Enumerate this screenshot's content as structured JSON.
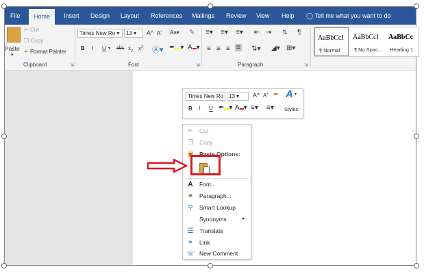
{
  "tabs": [
    {
      "label": "File"
    },
    {
      "label": "Home",
      "active": true
    },
    {
      "label": "Insert"
    },
    {
      "label": "Design"
    },
    {
      "label": "Layout"
    },
    {
      "label": "References"
    },
    {
      "label": "Mailings"
    },
    {
      "label": "Review"
    },
    {
      "label": "View"
    },
    {
      "label": "Help"
    }
  ],
  "tell_me": "Tell me what you want to do",
  "clipboard": {
    "paste": "Paste",
    "cut": "Cut",
    "copy": "Copy",
    "format_painter": "Format Painter",
    "label": "Clipboard"
  },
  "font": {
    "name": "Times New Ro",
    "size": "13",
    "label": "Font",
    "grow": "A",
    "shrink": "A",
    "case": "Aa",
    "bold": "B",
    "italic": "I",
    "underline": "U",
    "strike": "abc",
    "subscript": "x",
    "superscript": "x"
  },
  "paragraph": {
    "label": "Paragraph"
  },
  "styles": [
    {
      "sample": "AaBbCcI",
      "name": "¶ Normal"
    },
    {
      "sample": "AaBbCcI",
      "name": "¶ No Spac..."
    },
    {
      "sample": "AaBbCc",
      "name": "Heading 1"
    }
  ],
  "mini_toolbar": {
    "font": "Times New Ro",
    "size": "13",
    "bold": "B",
    "italic": "I",
    "underline": "U",
    "styles": "Styles"
  },
  "context_menu": {
    "cut": "Cut",
    "copy": "Copy",
    "paste_options": "Paste Options:",
    "font": "Font...",
    "paragraph": "Paragraph...",
    "smart_lookup": "Smart Lookup",
    "synonyms": "Synonyms",
    "translate": "Translate",
    "link": "Link",
    "new_comment": "New Comment"
  },
  "colors": {
    "ribbon_blue": "#2b579a",
    "highlight_red": "#e0161c",
    "arrow_red": "#e0161c"
  }
}
